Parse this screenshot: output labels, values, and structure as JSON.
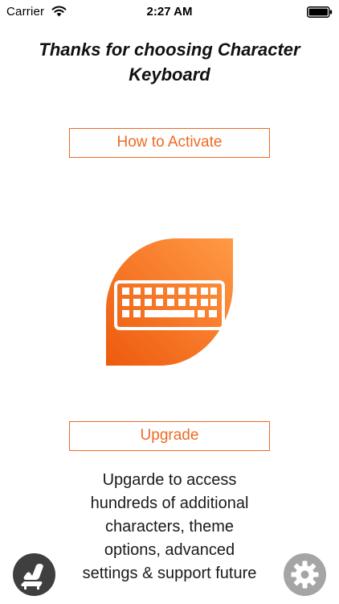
{
  "status_bar": {
    "carrier": "Carrier",
    "time": "2:27 AM"
  },
  "title": "Thanks for choosing Character Keyboard",
  "buttons": {
    "activate_label": "How to Activate",
    "upgrade_label": "Upgrade"
  },
  "description": "Upgarde to access hundreds of additional characters, theme options, advanced settings & support future",
  "icons": {
    "wifi": "wifi-icon",
    "battery": "battery-icon",
    "app": "keyboard-app-icon",
    "chair": "armchair-icon",
    "settings": "gear-icon"
  },
  "colors": {
    "accent": "#ee6a22",
    "icon_gradient_light": "#ff9a45",
    "icon_gradient_dark": "#ee5a0e",
    "chair_button": "#3f3f3f",
    "settings_button": "#a5a5a5"
  }
}
